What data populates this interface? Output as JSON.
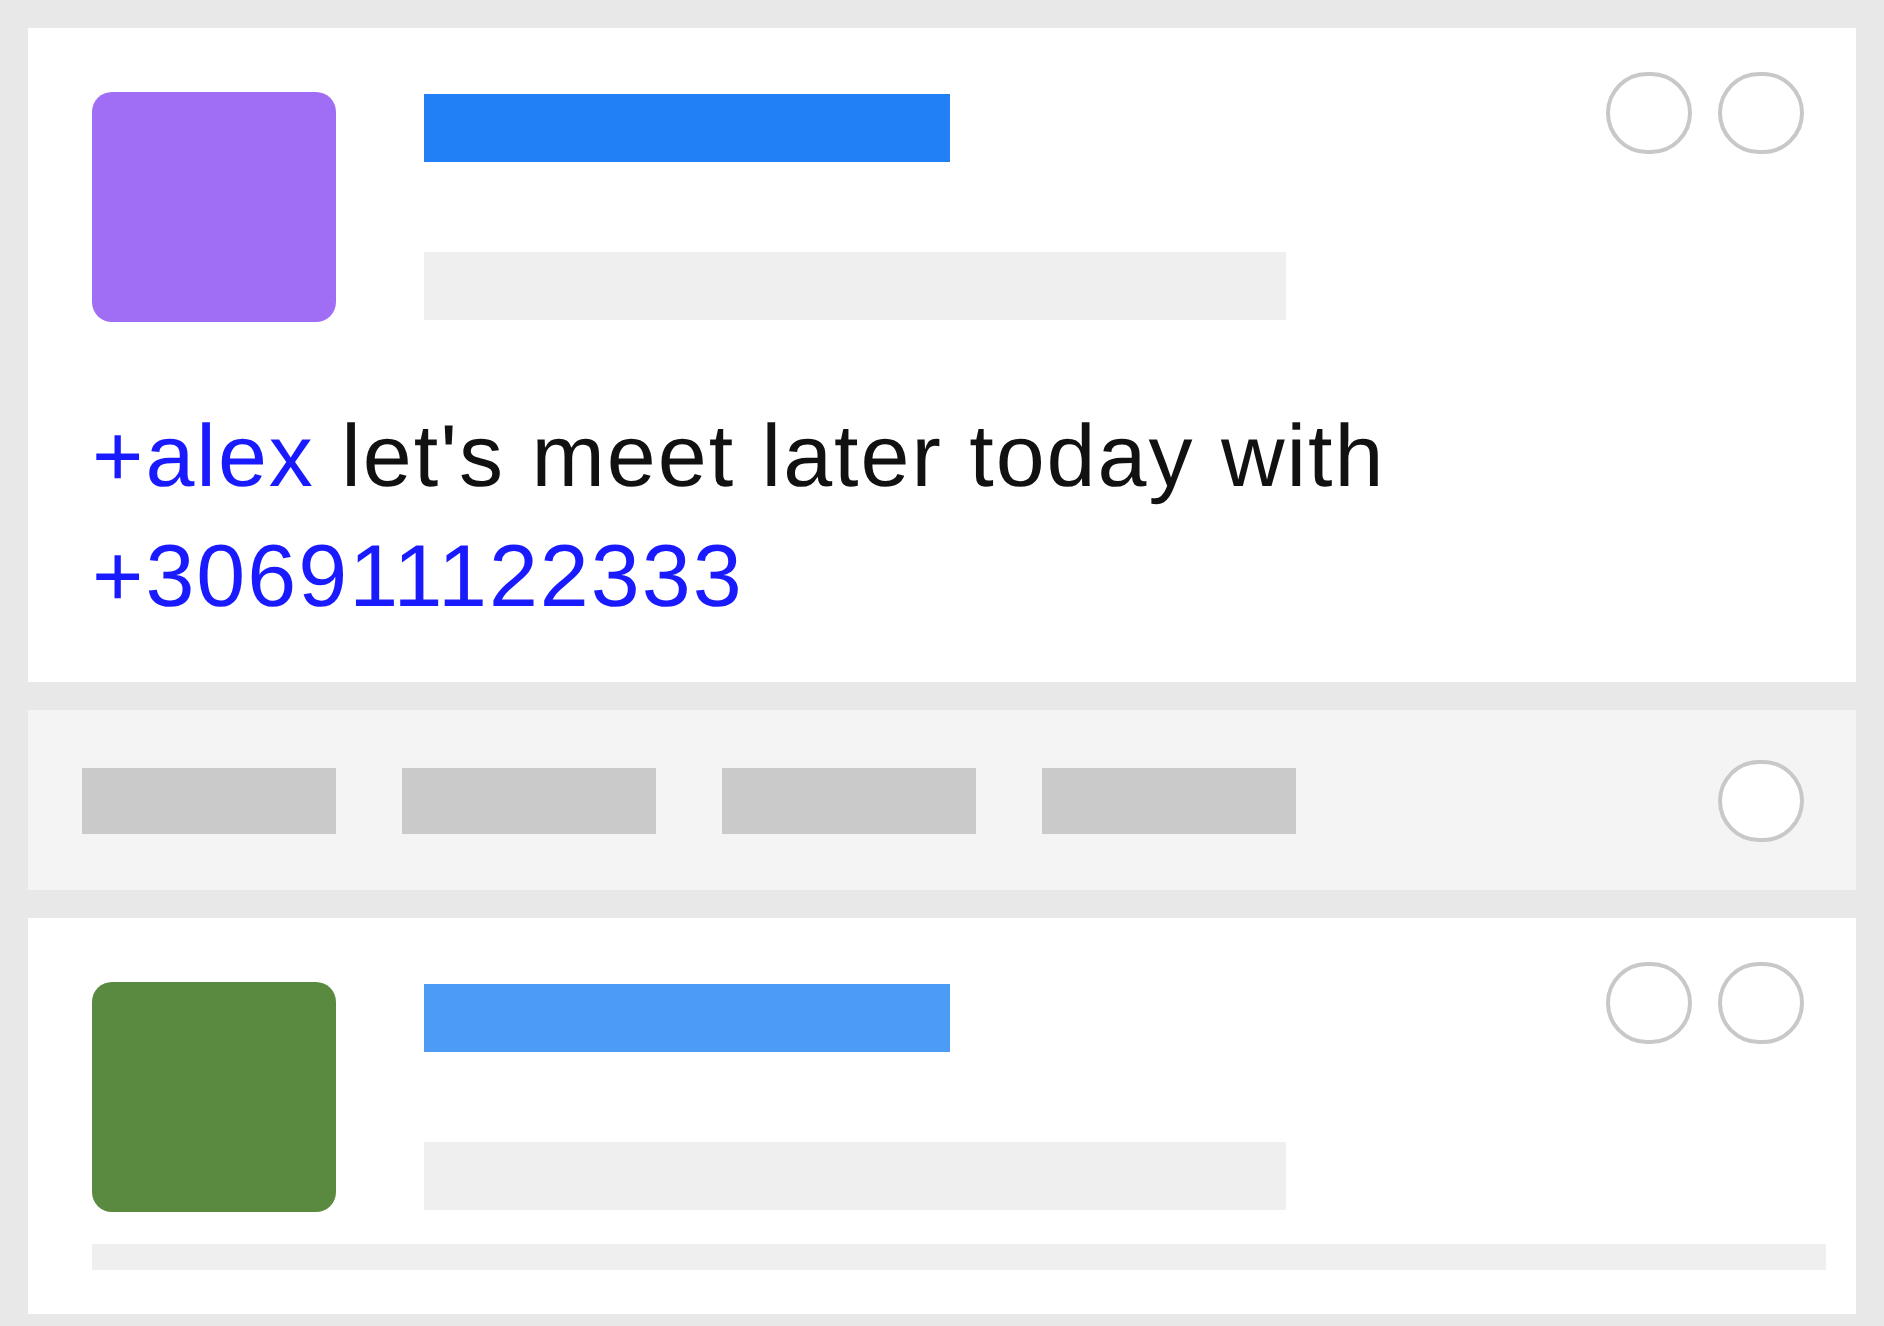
{
  "feed": [
    {
      "kind": "post",
      "avatar": {
        "color": "#a06ef5"
      },
      "title_bar": {
        "color": "#2180f5"
      },
      "message": [
        {
          "kind": "mention",
          "text": "+alex"
        },
        {
          "kind": "text",
          "text": "let's meet later today with"
        },
        {
          "kind": "phone",
          "text": "+306911122333"
        }
      ]
    },
    {
      "kind": "skeleton-row"
    },
    {
      "kind": "post",
      "avatar": {
        "color": "#5a8a40"
      },
      "title_bar": {
        "color": "#4c9cf6"
      }
    }
  ]
}
